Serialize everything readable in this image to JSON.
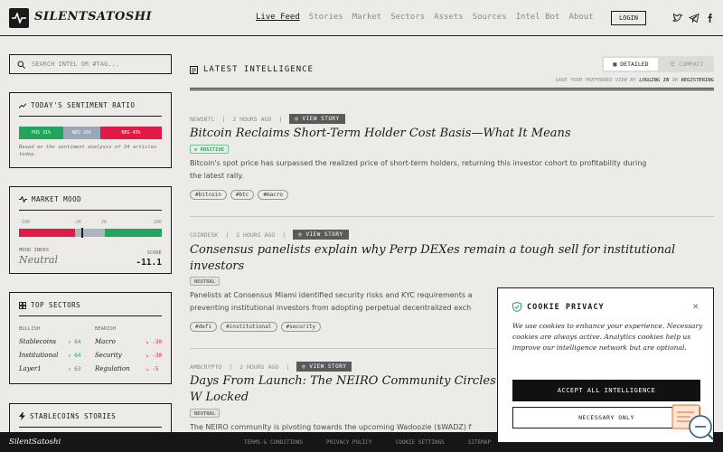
{
  "brand": "SILENTSATOSHI",
  "nav": [
    "Live Feed",
    "Stories",
    "Market",
    "Sectors",
    "Assets",
    "Sources",
    "Intel Bot",
    "About"
  ],
  "login_label": "LOGIN",
  "search": {
    "placeholder": "SEARCH INTEL OR #TAG..."
  },
  "sentiment": {
    "title": "TODAY'S SENTIMENT RATIO",
    "pos_label": "POS 31%",
    "neu_label": "NEU 26%",
    "neg_label": "NEG 43%",
    "pos": 31,
    "neu": 26,
    "neg": 43,
    "note": "Based on the sentiment analysis of 34 articles today.",
    "colors": {
      "pos": "#22a45d",
      "neu": "#9aa7b8",
      "neg": "#e01b45"
    }
  },
  "mood": {
    "title": "MARKET MOOD",
    "ticks": [
      "-100",
      "-26",
      "26",
      "100"
    ],
    "index_label": "MOOD INDEX",
    "index_value": "Neutral",
    "score_label": "SCORE",
    "score_value": "-11.1",
    "score": -11.1
  },
  "sectors": {
    "title": "TOP SECTORS",
    "bullish_label": "BULLISH",
    "bearish_label": "BEARISH",
    "bullish": [
      {
        "name": "Stablecoins",
        "value": "↗ 64"
      },
      {
        "name": "Institutional",
        "value": "↗ 64"
      },
      {
        "name": "Layer1",
        "value": "↗ 63"
      }
    ],
    "bearish": [
      {
        "name": "Macro",
        "value": "↘ -30"
      },
      {
        "name": "Security",
        "value": "↘ -30"
      },
      {
        "name": "Regulation",
        "value": "↘ -5"
      }
    ]
  },
  "stable_stories": {
    "title": "STABLECOINS STORIES"
  },
  "feed": {
    "title": "LATEST INTELLIGENCE",
    "toggle_detailed": "DETAILED",
    "toggle_compact": "COMPACT",
    "save_note_pre": "SAVE YOUR PREFERRED VIEW BY",
    "save_note_login": "LOGGING IN",
    "save_note_or": "OR",
    "save_note_register": "REGISTERING",
    "view_story": "VIEW STORY",
    "items": [
      {
        "source": "NEWSBTC",
        "time": "2 HOURS AGO",
        "title": "Bitcoin Reclaims Short-Term Holder Cost Basis—What It Means",
        "sentiment": "POSITIVE",
        "summary": "Bitcoin's spot price has surpassed the realized price of short-term holders, returning this investor cohort to profitability during the latest rally.",
        "tags": [
          "#bitcoin",
          "#btc",
          "#macro"
        ]
      },
      {
        "source": "COINDESK",
        "time": "2 HOURS AGO",
        "title": "Consensus panelists explain why Perp DEXes remain a tough sell for institutional investors",
        "sentiment": "NEUTRAL",
        "summary": "Panelists at Consensus Miami identified security risks and KYC requirements a preventing institutional investors from adopting perpetual decentralized exch",
        "tags": [
          "#defi",
          "#institutional",
          "#security"
        ]
      },
      {
        "source": "AMBCRYPTO",
        "time": "2 HOURS AGO",
        "title": "Days From Launch: The NEIRO Community Circles W Locked",
        "sentiment": "NEUTRAL",
        "summary": "The NEIRO community is pivoting towards the upcoming Wadoozie ($WADZ) f",
        "tags": []
      }
    ]
  },
  "cookie": {
    "title": "COOKIE PRIVACY",
    "text": "We use cookies to enhance your experience. Necessary cookies are always active. Analytics cookies help us improve our intelligence network but are optional.",
    "accept": "ACCEPT ALL INTELLIGENCE",
    "necessary": "NECESSARY ONLY"
  },
  "footer": {
    "brand": "SilentSatoshi",
    "links": [
      "TERMS & CONDITIONS",
      "PRIVACY POLICY",
      "COOKIE SETTINGS",
      "SITEMAP"
    ]
  }
}
